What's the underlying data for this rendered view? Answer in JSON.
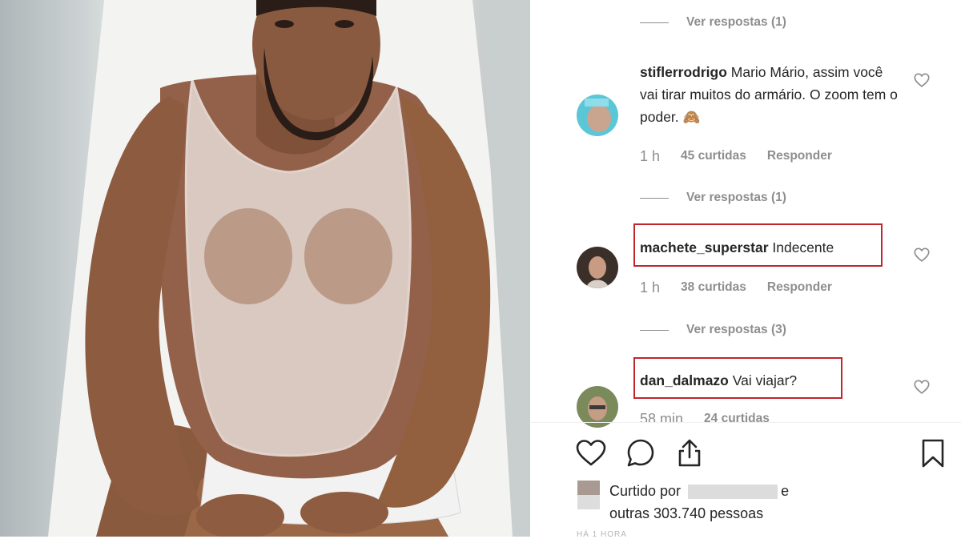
{
  "post": {
    "comments": [
      {
        "id": "c1",
        "username": "stiflerrodrigo",
        "text": "Mario Mário, assim você vai tirar muitos do armário. O zoom tem o poder. 🙈",
        "time": "1 h",
        "likes": "45 curtidas",
        "reply_label": "Responder",
        "view_replies": "Ver respostas (1)"
      },
      {
        "id": "c2",
        "username": "machete_superstar",
        "text": "Indecente",
        "time": "1 h",
        "likes": "38 curtidas",
        "reply_label": "Responder",
        "view_replies": "Ver respostas (3)"
      },
      {
        "id": "c3",
        "username": "dan_dalmazo",
        "text": "Vai viajar?",
        "time": "58 min",
        "likes": "24 curtidas"
      }
    ],
    "top_view_replies": "Ver respostas (1)",
    "liked_by_prefix": "Curtido por",
    "liked_by_and": "e",
    "liked_by_others": "outras 303.740 pessoas",
    "date_partial": "HÁ 1 HORA"
  },
  "icons": {
    "like": "heart-icon",
    "comment": "comment-icon",
    "share": "share-icon",
    "save": "bookmark-icon",
    "comment_like": "heart-small-icon"
  },
  "colors": {
    "highlight_box": "#c0262c",
    "muted_text": "#8e8e8e"
  }
}
